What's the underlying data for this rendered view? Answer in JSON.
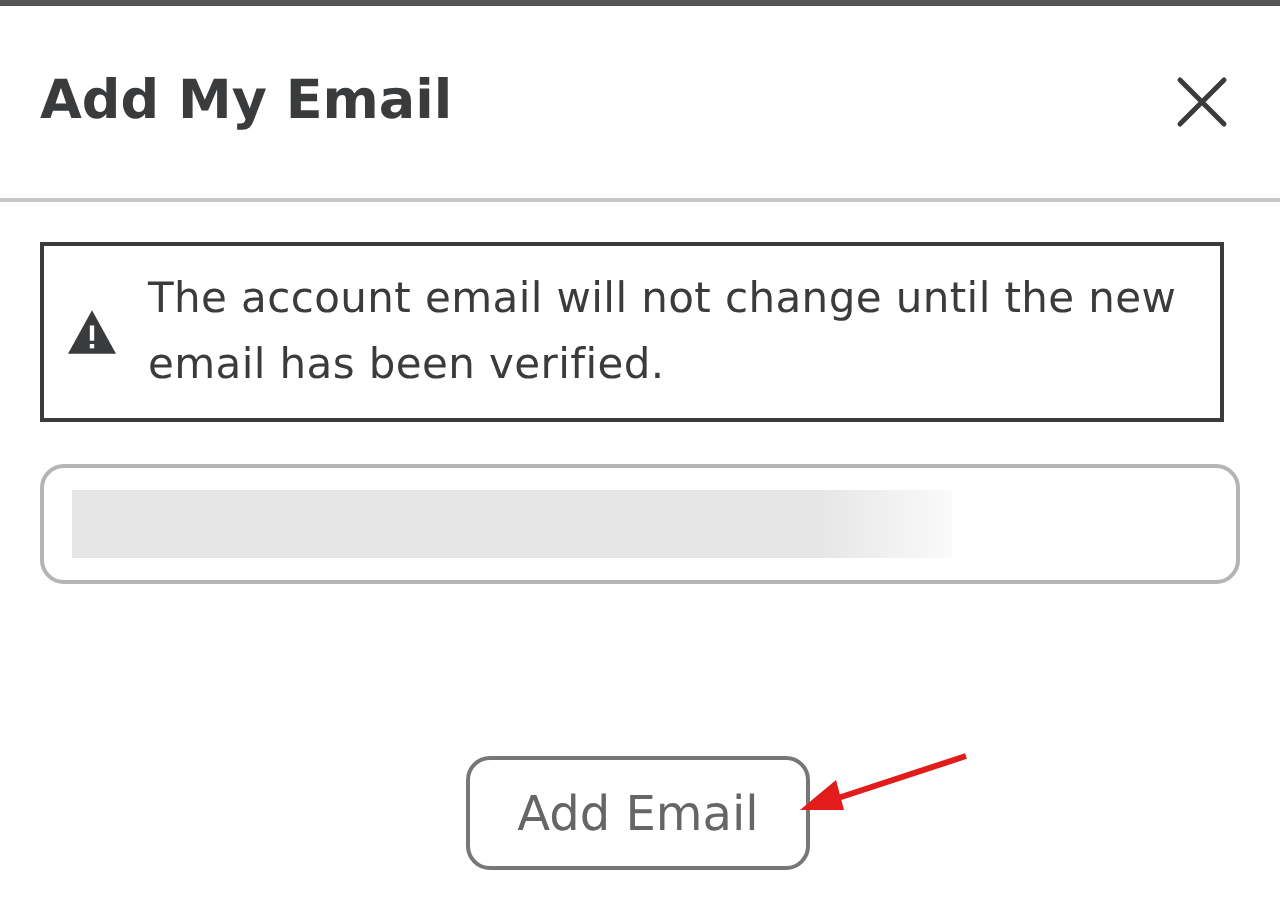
{
  "dialog": {
    "title": "Add My Email",
    "warning": "The account email will not change until the new email has been verified.",
    "button": "Add Email"
  }
}
